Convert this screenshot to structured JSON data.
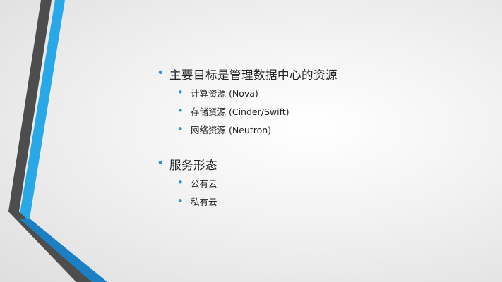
{
  "slide": {
    "colors": {
      "accent_blue": "#29a8e8",
      "dark_gray": "#4d4d4d",
      "bullet_blue": "#2a8fd6",
      "text": "#222222"
    },
    "bullet_glyph": "•",
    "groups": [
      {
        "title": "主要目标是管理数据中心的资源",
        "items": [
          "计算资源 (Nova)",
          "存储资源 (Cinder/Swift)",
          "网络资源 (Neutron)"
        ]
      },
      {
        "title": "服务形态",
        "items": [
          "公有云",
          "私有云"
        ]
      }
    ]
  }
}
